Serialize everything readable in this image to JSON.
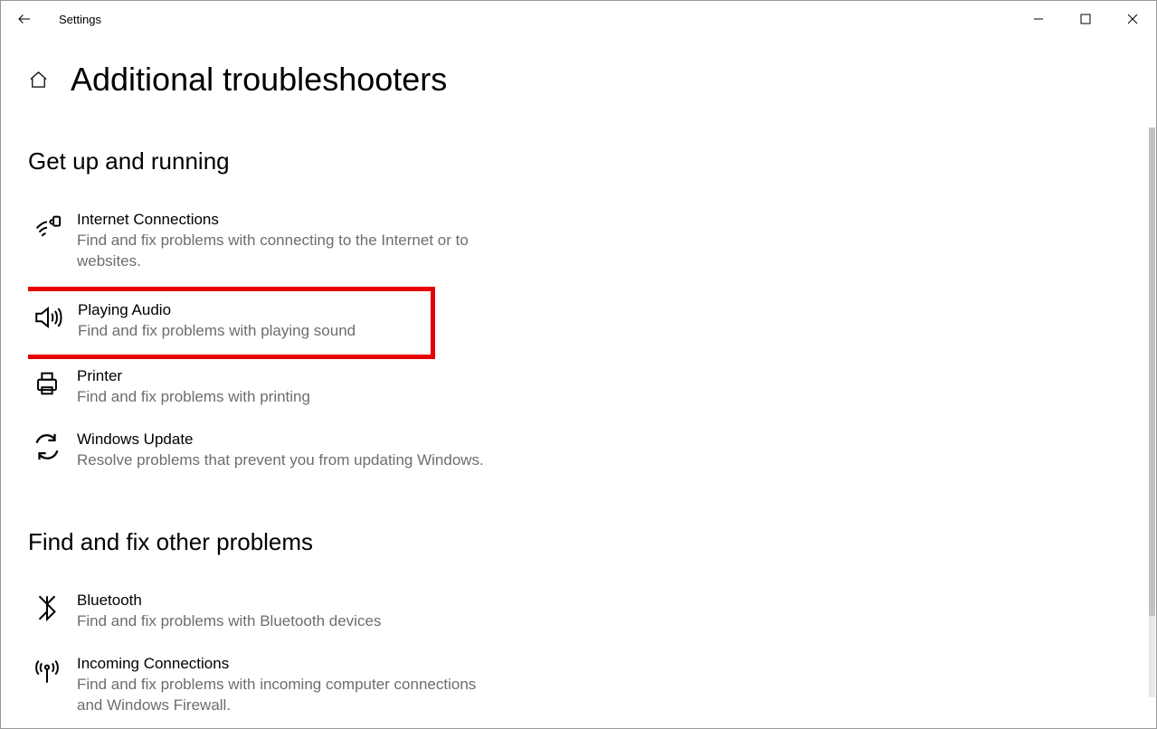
{
  "window": {
    "app_title": "Settings"
  },
  "page": {
    "title": "Additional troubleshooters"
  },
  "sections": {
    "get_up": {
      "title": "Get up and running",
      "items": [
        {
          "title": "Internet Connections",
          "desc": "Find and fix problems with connecting to the Internet or to websites."
        },
        {
          "title": "Playing Audio",
          "desc": "Find and fix problems with playing sound"
        },
        {
          "title": "Printer",
          "desc": "Find and fix problems with printing"
        },
        {
          "title": "Windows Update",
          "desc": "Resolve problems that prevent you from updating Windows."
        }
      ]
    },
    "find_fix": {
      "title": "Find and fix other problems",
      "items": [
        {
          "title": "Bluetooth",
          "desc": "Find and fix problems with Bluetooth devices"
        },
        {
          "title": "Incoming Connections",
          "desc": "Find and fix problems with incoming computer connections and Windows Firewall."
        }
      ]
    }
  }
}
